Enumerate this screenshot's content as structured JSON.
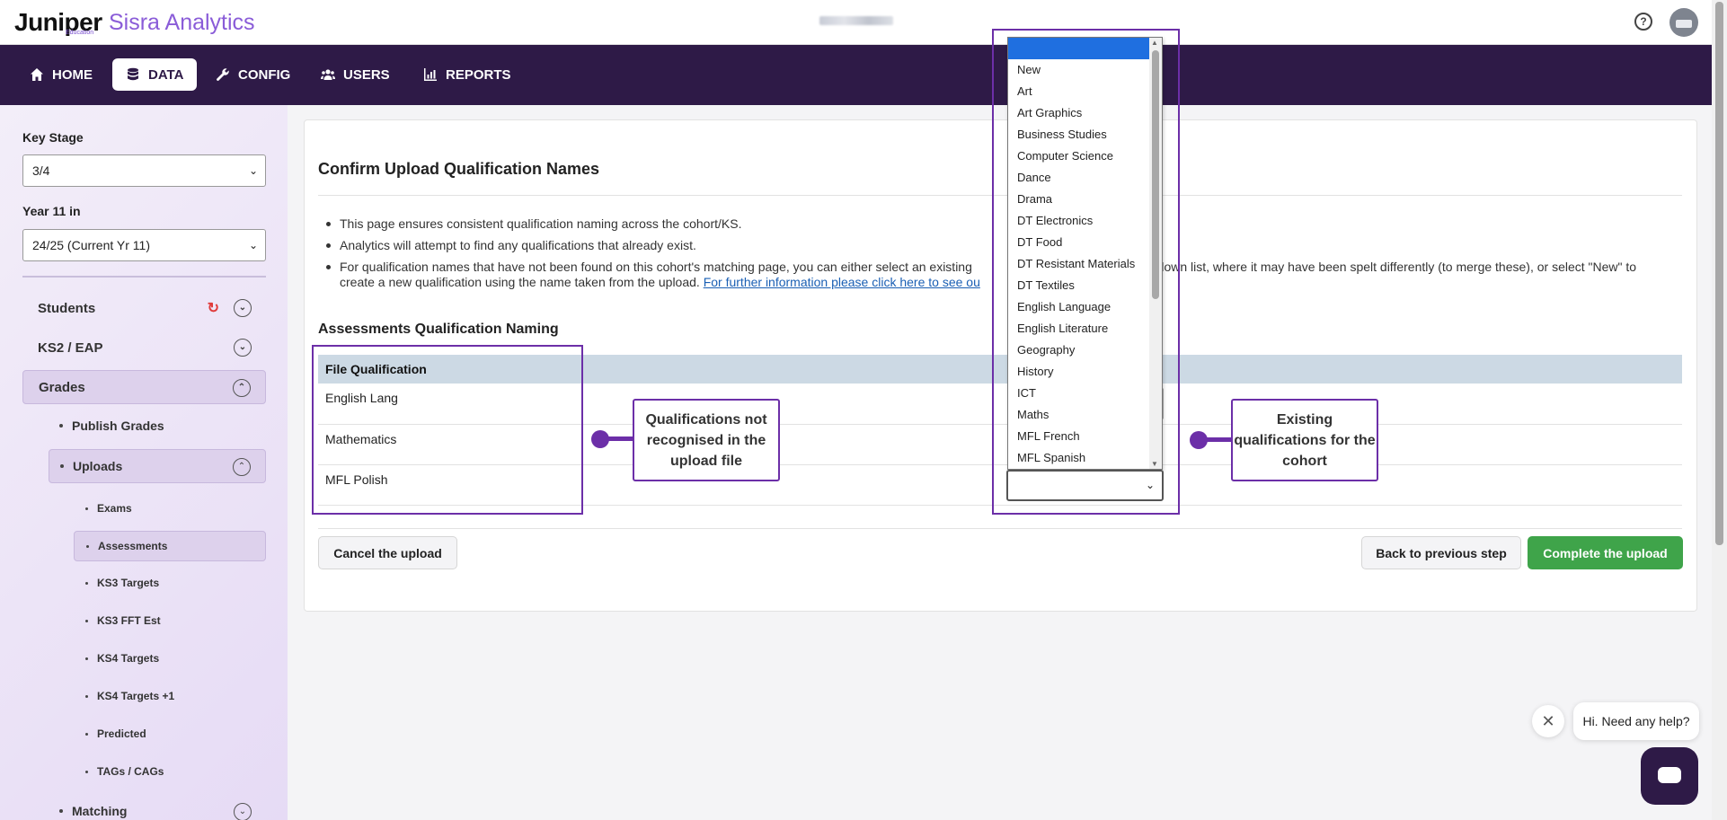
{
  "app": {
    "brand": "Juniper",
    "brand_sub": "Education",
    "product": "Sisra Analytics"
  },
  "nav": {
    "items": [
      {
        "label": "HOME",
        "icon": "home-icon"
      },
      {
        "label": "DATA",
        "icon": "database-icon",
        "active": true
      },
      {
        "label": "CONFIG",
        "icon": "wrench-icon"
      },
      {
        "label": "USERS",
        "icon": "users-icon"
      },
      {
        "label": "REPORTS",
        "icon": "chart-icon"
      }
    ]
  },
  "sidebar": {
    "key_stage_label": "Key Stage",
    "key_stage_value": "3/4",
    "year_label": "Year 11 in",
    "year_value": "24/25 (Current Yr 11)",
    "students": "Students",
    "ks2": "KS2 / EAP",
    "grades": "Grades",
    "publish_grades": "Publish Grades",
    "uploads": "Uploads",
    "upload_items": [
      "Exams",
      "Assessments",
      "KS3 Targets",
      "KS3 FFT Est",
      "KS4 Targets",
      "KS4 Targets +1",
      "Predicted",
      "TAGs / CAGs"
    ],
    "matching": "Matching"
  },
  "main": {
    "title": "Confirm Upload Qualification Names",
    "bullets": [
      "This page ensures consistent qualification naming across the cohort/KS.",
      "Analytics will attempt to find any qualifications that already exist.",
      "For qualification names that have not been found on this cohort's matching page, you can either select an existing"
    ],
    "bullet3_tail": "down list, where it may have been spelt differently (to merge these), or select \"New\" to",
    "bullet3_line2": "create a new qualification using the name taken from the upload.",
    "bullet3_link": "For further information please click here to see ou",
    "section_title": "Assessments Qualification Naming",
    "table_header": "File Qualification",
    "file_qualifications": [
      "English Lang",
      "Mathematics",
      "MFL Polish"
    ],
    "cancel_label": "Cancel the upload",
    "back_label": "Back to previous step",
    "complete_label": "Complete the upload"
  },
  "callouts": {
    "left": "Qualifications not recognised in the upload file",
    "right": "Existing qualifications for the cohort"
  },
  "dropdown": {
    "selected": "",
    "options": [
      "",
      "New",
      "Art",
      "Art Graphics",
      "Business Studies",
      "Computer Science",
      "Dance",
      "Drama",
      "DT Electronics",
      "DT Food",
      "DT Resistant Materials",
      "DT Textiles",
      "English Language",
      "English Literature",
      "Geography",
      "History",
      "ICT",
      "Maths",
      "MFL French",
      "MFL Spanish"
    ]
  },
  "chat": {
    "message": "Hi. Need any help?"
  },
  "colors": {
    "nav_bg": "#2e1a47",
    "accent_purple": "#6c2fa8",
    "complete_green": "#3fa44a",
    "selection_blue": "#1f6fe0"
  }
}
